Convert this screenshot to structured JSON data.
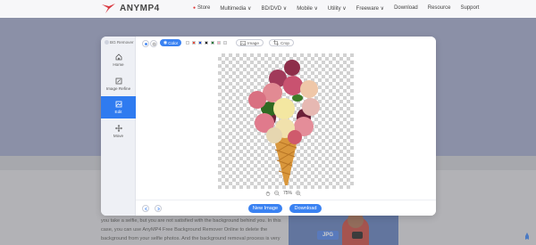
{
  "header": {
    "brand": "ANYMP4",
    "nav": [
      "Store",
      "Multimedia ∨",
      "BD/DVD ∨",
      "Mobile ∨",
      "Utility ∨",
      "Freeware ∨",
      "Download",
      "Resource",
      "Support"
    ]
  },
  "modal": {
    "app_title": "BG Remover",
    "sidebar": [
      {
        "label": "Home",
        "icon": "home-icon"
      },
      {
        "label": "Image Refine",
        "icon": "edit-icon"
      },
      {
        "label": "Edit",
        "icon": "crop-icon",
        "active": true
      },
      {
        "label": "Move",
        "icon": "move-icon"
      }
    ],
    "toolbar": {
      "color_label": "Color",
      "swatches": [
        "#ffffff",
        "#e74c3c",
        "#1e4ed8",
        "#111111",
        "#1a7a3a",
        "#ffb3c7",
        "#e9e9ef"
      ],
      "image_label": "Image",
      "crop_label": "Crop"
    },
    "zoom": "75%",
    "new_image_label": "New Image",
    "download_label": "Download"
  },
  "page": {
    "paragraph_lines": [
      "you take a selfie, but you are not satisfied with the background behind you. In this",
      "case, you can use AnyMP4 Free Background Remover Online to delete the",
      "background from your selfie photos. And the background removal process is very"
    ],
    "promo_badge": "JPG"
  },
  "colors": {
    "accent": "#3a82f2",
    "brand": "#d9363e",
    "hero": "#9ba4c6"
  }
}
